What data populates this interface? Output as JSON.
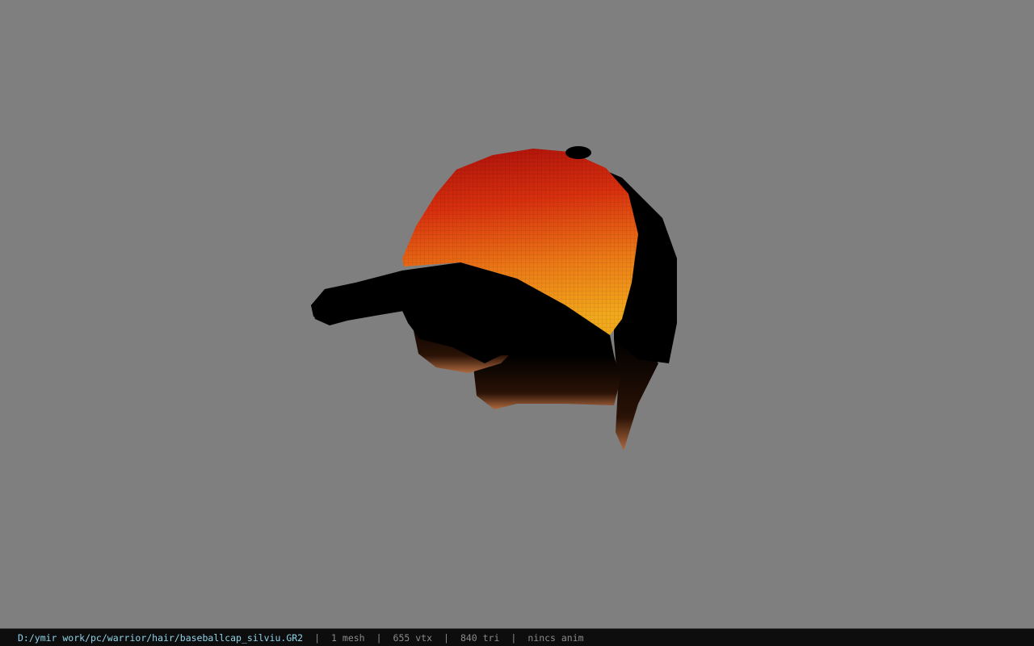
{
  "statusbar": {
    "file_path": "D:/ymir work/pc/warrior/hair/baseballcap_silviu.GR2",
    "mesh_count": "1 mesh",
    "vertex_count": "655 vtx",
    "triangle_count": "840 tri",
    "animation": "nincs anim"
  },
  "viewport": {
    "background_color": "#7f7f7f",
    "model_colors": {
      "crown_top": "#b4140a",
      "crown_bottom": "#f0a01c",
      "shadow": "#000000",
      "hair_edge": "#a8603a"
    }
  }
}
